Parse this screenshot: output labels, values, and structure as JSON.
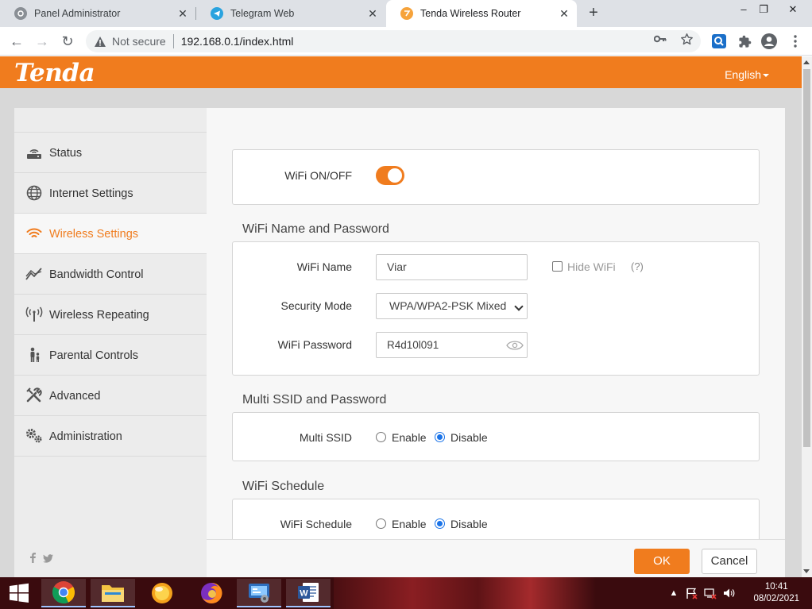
{
  "browser": {
    "tabs": [
      {
        "title": "Panel Administrator",
        "icon": "settings-favicon-icon"
      },
      {
        "title": "Telegram Web",
        "icon": "telegram-icon"
      },
      {
        "title": "Tenda Wireless Router",
        "icon": "tenda-favicon-icon",
        "active": true
      }
    ],
    "security_label": "Not secure",
    "url": "192.168.0.1/index.html"
  },
  "header": {
    "logo": "Tenda",
    "language": "English"
  },
  "sidebar": {
    "items": [
      {
        "label": "Status",
        "icon": "router-icon"
      },
      {
        "label": "Internet Settings",
        "icon": "globe-icon"
      },
      {
        "label": "Wireless Settings",
        "icon": "wifi-icon",
        "active": true
      },
      {
        "label": "Bandwidth Control",
        "icon": "bandwidth-chart-icon"
      },
      {
        "label": "Wireless Repeating",
        "icon": "antenna-icon"
      },
      {
        "label": "Parental Controls",
        "icon": "family-icon"
      },
      {
        "label": "Advanced",
        "icon": "tools-icon"
      },
      {
        "label": "Administration",
        "icon": "gears-icon"
      }
    ]
  },
  "wifi_switch": {
    "label": "WiFi ON/OFF",
    "enabled": true
  },
  "wifi_name_password": {
    "title": "WiFi Name and Password",
    "name_label": "WiFi Name",
    "name_value": "Viar",
    "hide_wifi_label": "Hide WiFi",
    "help_label": "(?)",
    "security_label": "Security Mode",
    "security_value": "WPA/WPA2-PSK Mixed",
    "password_label": "WiFi Password",
    "password_value": "R4d10l091"
  },
  "multi_ssid": {
    "title": "Multi SSID and Password",
    "label": "Multi SSID",
    "enable_label": "Enable",
    "disable_label": "Disable",
    "selected": "Disable"
  },
  "wifi_schedule": {
    "title": "WiFi Schedule",
    "label": "WiFi Schedule",
    "enable_label": "Enable",
    "disable_label": "Disable",
    "selected": "Disable"
  },
  "footer": {
    "ok_label": "OK",
    "cancel_label": "Cancel"
  },
  "taskbar": {
    "time": "10:41",
    "date": "08/02/2021"
  },
  "colors": {
    "brand_orange": "#f07c1e",
    "radio_blue": "#1a73e8"
  }
}
